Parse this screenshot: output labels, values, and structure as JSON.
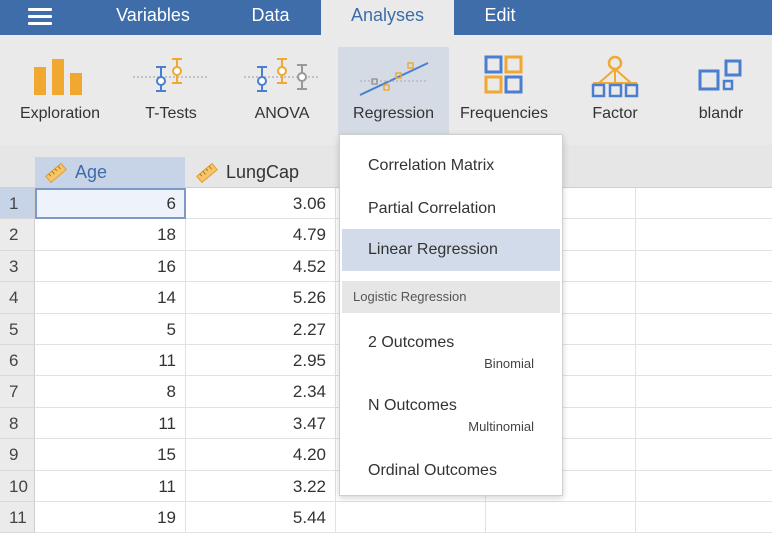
{
  "menu": {
    "tabs": [
      {
        "label": "Variables"
      },
      {
        "label": "Data"
      },
      {
        "label": "Analyses",
        "active": true
      },
      {
        "label": "Edit"
      }
    ]
  },
  "ribbon": {
    "buttons": [
      {
        "label": "Exploration",
        "icon": "bar-chart-icon"
      },
      {
        "label": "T-Tests",
        "icon": "t-test-icon"
      },
      {
        "label": "ANOVA",
        "icon": "anova-icon"
      },
      {
        "label": "Regression",
        "icon": "regression-icon",
        "active": true
      },
      {
        "label": "Frequencies",
        "icon": "frequencies-icon"
      },
      {
        "label": "Factor",
        "icon": "factor-icon"
      },
      {
        "label": "blandr",
        "icon": "blandr-icon"
      }
    ]
  },
  "sheet": {
    "columns": [
      {
        "name": "Age",
        "selected": true,
        "icon": "ruler-icon"
      },
      {
        "name": "LungCap",
        "icon": "ruler-icon"
      }
    ],
    "rows": [
      {
        "num": "1",
        "age": "6",
        "lungcap": "3.06"
      },
      {
        "num": "2",
        "age": "18",
        "lungcap": "4.79"
      },
      {
        "num": "3",
        "age": "16",
        "lungcap": "4.52"
      },
      {
        "num": "4",
        "age": "14",
        "lungcap": "5.26"
      },
      {
        "num": "5",
        "age": "5",
        "lungcap": "2.27"
      },
      {
        "num": "6",
        "age": "11",
        "lungcap": "2.95"
      },
      {
        "num": "7",
        "age": "8",
        "lungcap": "2.34"
      },
      {
        "num": "8",
        "age": "11",
        "lungcap": "3.47"
      },
      {
        "num": "9",
        "age": "15",
        "lungcap": "4.20"
      },
      {
        "num": "10",
        "age": "11",
        "lungcap": "3.22"
      },
      {
        "num": "11",
        "age": "19",
        "lungcap": "5.44"
      }
    ]
  },
  "dropdown": {
    "items": [
      {
        "label": "Correlation Matrix"
      },
      {
        "label": "Partial Correlation"
      },
      {
        "label": "Linear Regression",
        "highlighted": true
      }
    ],
    "section_label": "Logistic Regression",
    "logistic": [
      {
        "label": "2 Outcomes",
        "sub": "Binomial"
      },
      {
        "label": "N Outcomes",
        "sub": "Multinomial"
      },
      {
        "label": "Ordinal Outcomes"
      }
    ]
  },
  "colors": {
    "topbar": "#3e6da9",
    "ribbon_bg": "#eaeaea",
    "accent_orange": "#f0a830",
    "accent_blue": "#4a7fd0",
    "highlight": "#d2dbe9"
  }
}
